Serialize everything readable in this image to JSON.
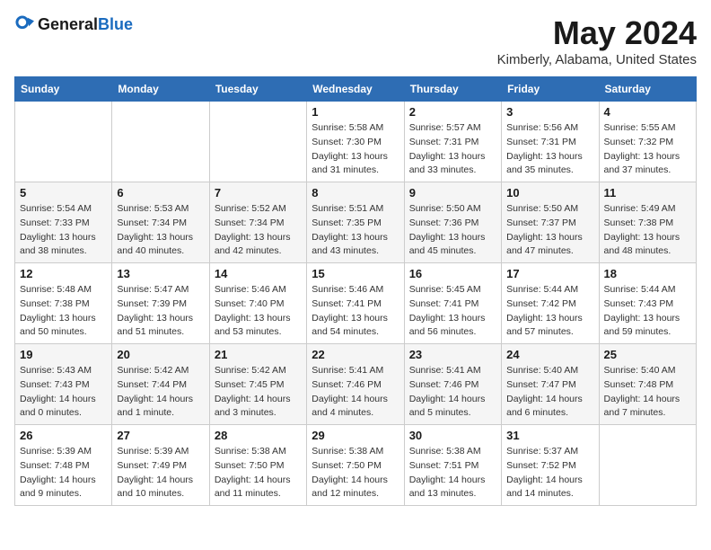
{
  "header": {
    "logo_general": "General",
    "logo_blue": "Blue",
    "month_year": "May 2024",
    "location": "Kimberly, Alabama, United States"
  },
  "days_of_week": [
    "Sunday",
    "Monday",
    "Tuesday",
    "Wednesday",
    "Thursday",
    "Friday",
    "Saturday"
  ],
  "weeks": [
    [
      {
        "day": null,
        "sunrise": null,
        "sunset": null,
        "daylight": null
      },
      {
        "day": null,
        "sunrise": null,
        "sunset": null,
        "daylight": null
      },
      {
        "day": null,
        "sunrise": null,
        "sunset": null,
        "daylight": null
      },
      {
        "day": "1",
        "sunrise": "Sunrise: 5:58 AM",
        "sunset": "Sunset: 7:30 PM",
        "daylight": "Daylight: 13 hours and 31 minutes."
      },
      {
        "day": "2",
        "sunrise": "Sunrise: 5:57 AM",
        "sunset": "Sunset: 7:31 PM",
        "daylight": "Daylight: 13 hours and 33 minutes."
      },
      {
        "day": "3",
        "sunrise": "Sunrise: 5:56 AM",
        "sunset": "Sunset: 7:31 PM",
        "daylight": "Daylight: 13 hours and 35 minutes."
      },
      {
        "day": "4",
        "sunrise": "Sunrise: 5:55 AM",
        "sunset": "Sunset: 7:32 PM",
        "daylight": "Daylight: 13 hours and 37 minutes."
      }
    ],
    [
      {
        "day": "5",
        "sunrise": "Sunrise: 5:54 AM",
        "sunset": "Sunset: 7:33 PM",
        "daylight": "Daylight: 13 hours and 38 minutes."
      },
      {
        "day": "6",
        "sunrise": "Sunrise: 5:53 AM",
        "sunset": "Sunset: 7:34 PM",
        "daylight": "Daylight: 13 hours and 40 minutes."
      },
      {
        "day": "7",
        "sunrise": "Sunrise: 5:52 AM",
        "sunset": "Sunset: 7:34 PM",
        "daylight": "Daylight: 13 hours and 42 minutes."
      },
      {
        "day": "8",
        "sunrise": "Sunrise: 5:51 AM",
        "sunset": "Sunset: 7:35 PM",
        "daylight": "Daylight: 13 hours and 43 minutes."
      },
      {
        "day": "9",
        "sunrise": "Sunrise: 5:50 AM",
        "sunset": "Sunset: 7:36 PM",
        "daylight": "Daylight: 13 hours and 45 minutes."
      },
      {
        "day": "10",
        "sunrise": "Sunrise: 5:50 AM",
        "sunset": "Sunset: 7:37 PM",
        "daylight": "Daylight: 13 hours and 47 minutes."
      },
      {
        "day": "11",
        "sunrise": "Sunrise: 5:49 AM",
        "sunset": "Sunset: 7:38 PM",
        "daylight": "Daylight: 13 hours and 48 minutes."
      }
    ],
    [
      {
        "day": "12",
        "sunrise": "Sunrise: 5:48 AM",
        "sunset": "Sunset: 7:38 PM",
        "daylight": "Daylight: 13 hours and 50 minutes."
      },
      {
        "day": "13",
        "sunrise": "Sunrise: 5:47 AM",
        "sunset": "Sunset: 7:39 PM",
        "daylight": "Daylight: 13 hours and 51 minutes."
      },
      {
        "day": "14",
        "sunrise": "Sunrise: 5:46 AM",
        "sunset": "Sunset: 7:40 PM",
        "daylight": "Daylight: 13 hours and 53 minutes."
      },
      {
        "day": "15",
        "sunrise": "Sunrise: 5:46 AM",
        "sunset": "Sunset: 7:41 PM",
        "daylight": "Daylight: 13 hours and 54 minutes."
      },
      {
        "day": "16",
        "sunrise": "Sunrise: 5:45 AM",
        "sunset": "Sunset: 7:41 PM",
        "daylight": "Daylight: 13 hours and 56 minutes."
      },
      {
        "day": "17",
        "sunrise": "Sunrise: 5:44 AM",
        "sunset": "Sunset: 7:42 PM",
        "daylight": "Daylight: 13 hours and 57 minutes."
      },
      {
        "day": "18",
        "sunrise": "Sunrise: 5:44 AM",
        "sunset": "Sunset: 7:43 PM",
        "daylight": "Daylight: 13 hours and 59 minutes."
      }
    ],
    [
      {
        "day": "19",
        "sunrise": "Sunrise: 5:43 AM",
        "sunset": "Sunset: 7:43 PM",
        "daylight": "Daylight: 14 hours and 0 minutes."
      },
      {
        "day": "20",
        "sunrise": "Sunrise: 5:42 AM",
        "sunset": "Sunset: 7:44 PM",
        "daylight": "Daylight: 14 hours and 1 minute."
      },
      {
        "day": "21",
        "sunrise": "Sunrise: 5:42 AM",
        "sunset": "Sunset: 7:45 PM",
        "daylight": "Daylight: 14 hours and 3 minutes."
      },
      {
        "day": "22",
        "sunrise": "Sunrise: 5:41 AM",
        "sunset": "Sunset: 7:46 PM",
        "daylight": "Daylight: 14 hours and 4 minutes."
      },
      {
        "day": "23",
        "sunrise": "Sunrise: 5:41 AM",
        "sunset": "Sunset: 7:46 PM",
        "daylight": "Daylight: 14 hours and 5 minutes."
      },
      {
        "day": "24",
        "sunrise": "Sunrise: 5:40 AM",
        "sunset": "Sunset: 7:47 PM",
        "daylight": "Daylight: 14 hours and 6 minutes."
      },
      {
        "day": "25",
        "sunrise": "Sunrise: 5:40 AM",
        "sunset": "Sunset: 7:48 PM",
        "daylight": "Daylight: 14 hours and 7 minutes."
      }
    ],
    [
      {
        "day": "26",
        "sunrise": "Sunrise: 5:39 AM",
        "sunset": "Sunset: 7:48 PM",
        "daylight": "Daylight: 14 hours and 9 minutes."
      },
      {
        "day": "27",
        "sunrise": "Sunrise: 5:39 AM",
        "sunset": "Sunset: 7:49 PM",
        "daylight": "Daylight: 14 hours and 10 minutes."
      },
      {
        "day": "28",
        "sunrise": "Sunrise: 5:38 AM",
        "sunset": "Sunset: 7:50 PM",
        "daylight": "Daylight: 14 hours and 11 minutes."
      },
      {
        "day": "29",
        "sunrise": "Sunrise: 5:38 AM",
        "sunset": "Sunset: 7:50 PM",
        "daylight": "Daylight: 14 hours and 12 minutes."
      },
      {
        "day": "30",
        "sunrise": "Sunrise: 5:38 AM",
        "sunset": "Sunset: 7:51 PM",
        "daylight": "Daylight: 14 hours and 13 minutes."
      },
      {
        "day": "31",
        "sunrise": "Sunrise: 5:37 AM",
        "sunset": "Sunset: 7:52 PM",
        "daylight": "Daylight: 14 hours and 14 minutes."
      },
      {
        "day": null,
        "sunrise": null,
        "sunset": null,
        "daylight": null
      }
    ]
  ]
}
